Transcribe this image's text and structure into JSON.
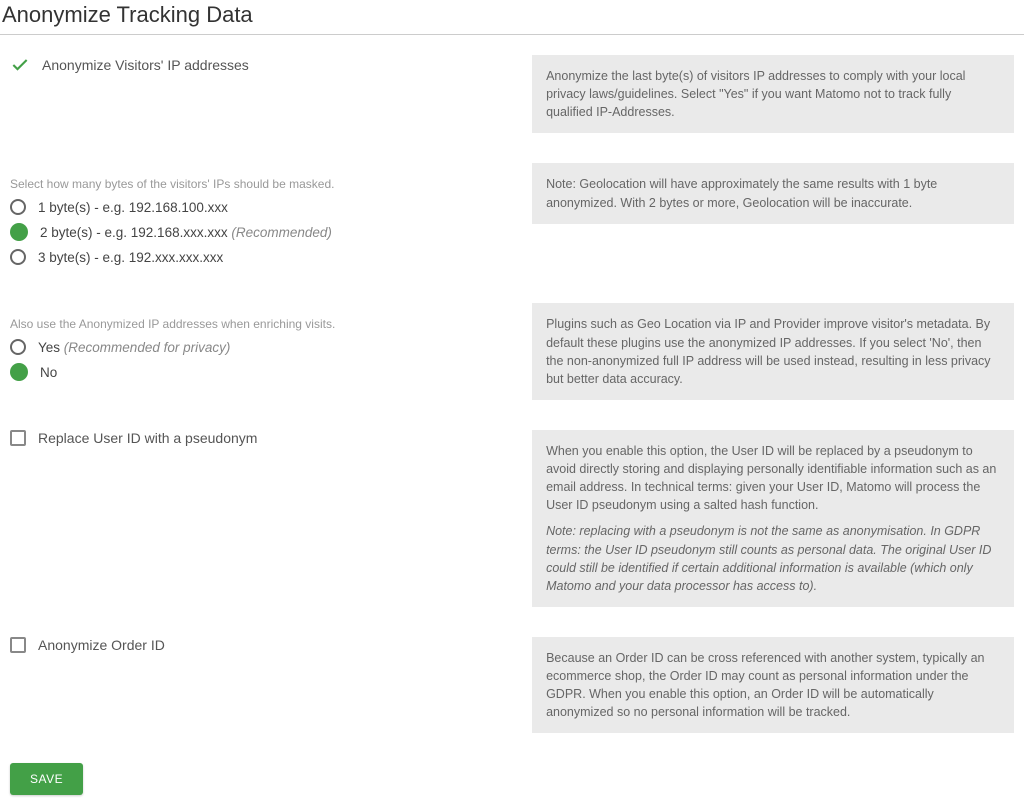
{
  "title": "Anonymize Tracking Data",
  "sections": {
    "anonymize_ip": {
      "label": "Anonymize Visitors' IP addresses",
      "checked": true,
      "help": "Anonymize the last byte(s) of visitors IP addresses to comply with your local privacy laws/guidelines. Select \"Yes\" if you want Matomo not to track fully qualified IP-Addresses."
    },
    "mask_bytes": {
      "sublabel": "Select how many bytes of the visitors' IPs should be masked.",
      "options": [
        {
          "label": "1 byte(s) - e.g. 192.168.100.xxx",
          "rec": "",
          "selected": false
        },
        {
          "label": "2 byte(s) - e.g. 192.168.xxx.xxx",
          "rec": "(Recommended)",
          "selected": true
        },
        {
          "label": "3 byte(s) - e.g. 192.xxx.xxx.xxx",
          "rec": "",
          "selected": false
        }
      ],
      "help": "Note: Geolocation will have approximately the same results with 1 byte anonymized. With 2 bytes or more, Geolocation will be inaccurate."
    },
    "enrich": {
      "sublabel": "Also use the Anonymized IP addresses when enriching visits.",
      "options": [
        {
          "label": "Yes",
          "rec": "(Recommended for privacy)",
          "selected": false
        },
        {
          "label": "No",
          "rec": "",
          "selected": true
        }
      ],
      "help": "Plugins such as Geo Location via IP and Provider improve visitor's metadata. By default these plugins use the anonymized IP addresses. If you select 'No', then the non-anonymized full IP address will be used instead, resulting in less privacy but better data accuracy."
    },
    "replace_userid": {
      "label": "Replace User ID with a pseudonym",
      "checked": false,
      "help": "When you enable this option, the User ID will be replaced by a pseudonym to avoid directly storing and displaying personally identifiable information such as an email address. In technical terms: given your User ID, Matomo will process the User ID pseudonym using a salted hash function.",
      "help_note": "Note: replacing with a pseudonym is not the same as anonymisation. In GDPR terms: the User ID pseudonym still counts as personal data. The original User ID could still be identified if certain additional information is available (which only Matomo and your data processor has access to)."
    },
    "anonymize_order": {
      "label": "Anonymize Order ID",
      "checked": false,
      "help": "Because an Order ID can be cross referenced with another system, typically an ecommerce shop, the Order ID may count as personal information under the GDPR. When you enable this option, an Order ID will be automatically anonymized so no personal information will be tracked."
    }
  },
  "buttons": {
    "save": "SAVE"
  }
}
